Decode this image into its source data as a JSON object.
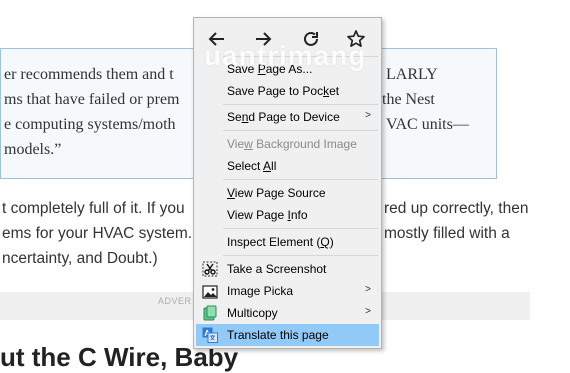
{
  "article": {
    "quote_lines": [
      "er recommends them and t",
      "ms that have failed or prem",
      "e computing systems/moth",
      " models.”"
    ],
    "quote_right": [
      "LARLY",
      " the Nest",
      "VAC units—"
    ],
    "para_lines": [
      "t completely full of it. If you",
      "ems for your HVAC system.",
      "ncertainty, and Doubt.)"
    ],
    "para_right": [
      "red up correctly, then",
      " mostly filled with a"
    ],
    "advert_label": "ADVER",
    "heading": "ut the C Wire, Baby"
  },
  "watermark": "uantrimang",
  "menu": {
    "nav": [
      {
        "name": "back",
        "icon": "arrow-left-icon"
      },
      {
        "name": "forward",
        "icon": "arrow-right-icon"
      },
      {
        "name": "reload",
        "icon": "reload-icon"
      },
      {
        "name": "bookmark",
        "icon": "star-icon"
      }
    ],
    "items": {
      "save_page_as": {
        "pre": "Save ",
        "acc": "P",
        "post": "age As..."
      },
      "save_to_pocket": {
        "pre": "Save Page to Poc",
        "acc": "k",
        "post": "et"
      },
      "send_to_device": {
        "pre": "Se",
        "acc": "n",
        "post": "d Page to Device"
      },
      "view_bg_image": {
        "pre": "Vie",
        "acc": "w",
        "post": " Background Image"
      },
      "select_all": {
        "pre": "Select ",
        "acc": "A",
        "post": "ll"
      },
      "view_source": {
        "pre": "",
        "acc": "V",
        "post": "iew Page Source"
      },
      "view_info": {
        "pre": "View Page ",
        "acc": "I",
        "post": "nfo"
      },
      "inspect": {
        "pre": "Inspect Element (",
        "acc": "Q",
        "post": ")"
      },
      "screenshot": {
        "label": "Take a Screenshot"
      },
      "image_picka": {
        "label": "Image Picka"
      },
      "multicopy": {
        "label": "Multicopy"
      },
      "translate": {
        "label": "Translate this page"
      }
    },
    "submenu_arrow": ">"
  }
}
